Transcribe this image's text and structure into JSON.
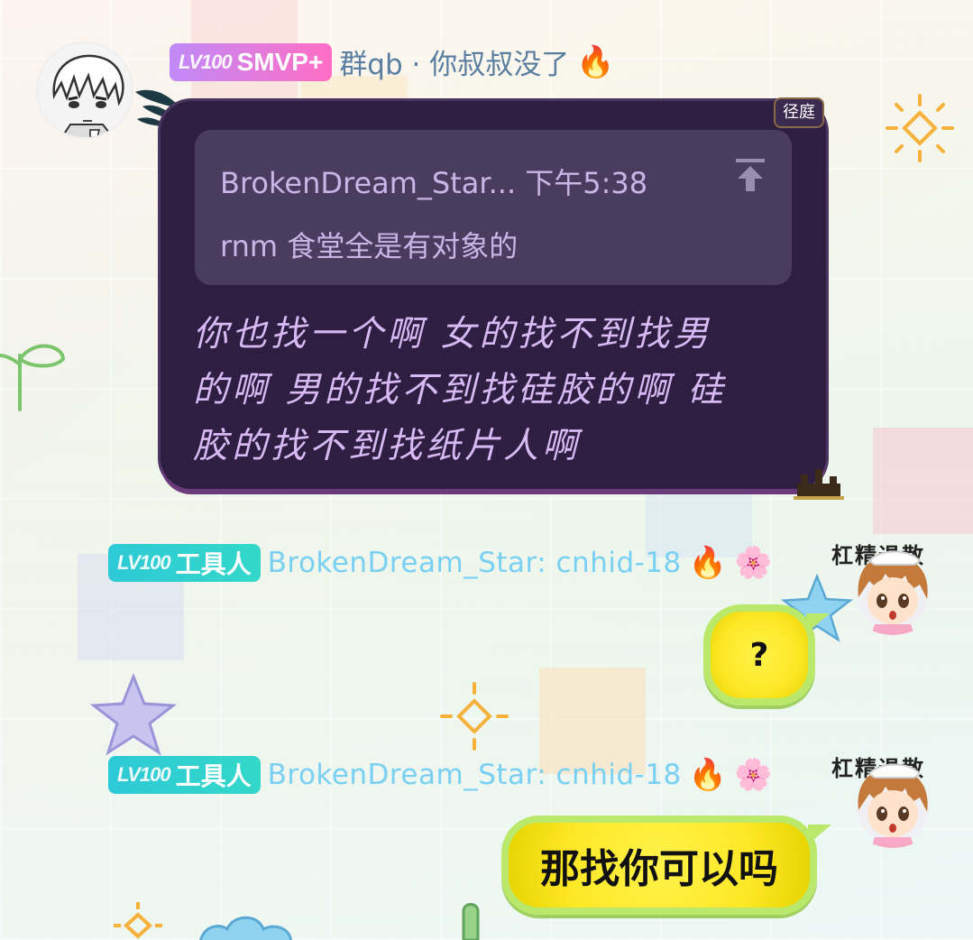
{
  "messages": [
    {
      "badge": {
        "level": "LV100",
        "title": "SMVP+"
      },
      "sender": "群qb · 你叔叔没了",
      "corner_tag": "径庭",
      "quote": {
        "author_time": "BrokenDream_Star... 下午5:38",
        "text": "rnm 食堂全是有对象的"
      },
      "body_lines": [
        "你也找一个啊 女的找不到找男",
        "的啊 男的找不到找硅胶的啊 硅",
        "胶的找不到找纸片人啊"
      ]
    },
    {
      "badge": {
        "level": "LV100",
        "title": "工具人"
      },
      "sender": "BrokenDream_Star: cnhid-18",
      "sticker_text": "杠精退散",
      "bubble_text": "?"
    },
    {
      "badge": {
        "level": "LV100",
        "title": "工具人"
      },
      "sender": "BrokenDream_Star: cnhid-18",
      "sticker_text": "杠精退散",
      "bubble_text": "那找你可以吗"
    }
  ],
  "icons": [
    "fire-icon",
    "flower-smile-icon",
    "pin-top-icon",
    "feather-icon",
    "castle-icon"
  ],
  "colors": {
    "dark_bubble": "#2e1f42",
    "quote_box": "#4a3c5e",
    "quote_text": "#c9b5e6",
    "body_text": "#d7b9f3",
    "yellow_bubble": "#fde725",
    "teal_badge": "#2ec9d6",
    "purple_badge": "#c08af7",
    "sender_blue": "#7ad0f2"
  }
}
